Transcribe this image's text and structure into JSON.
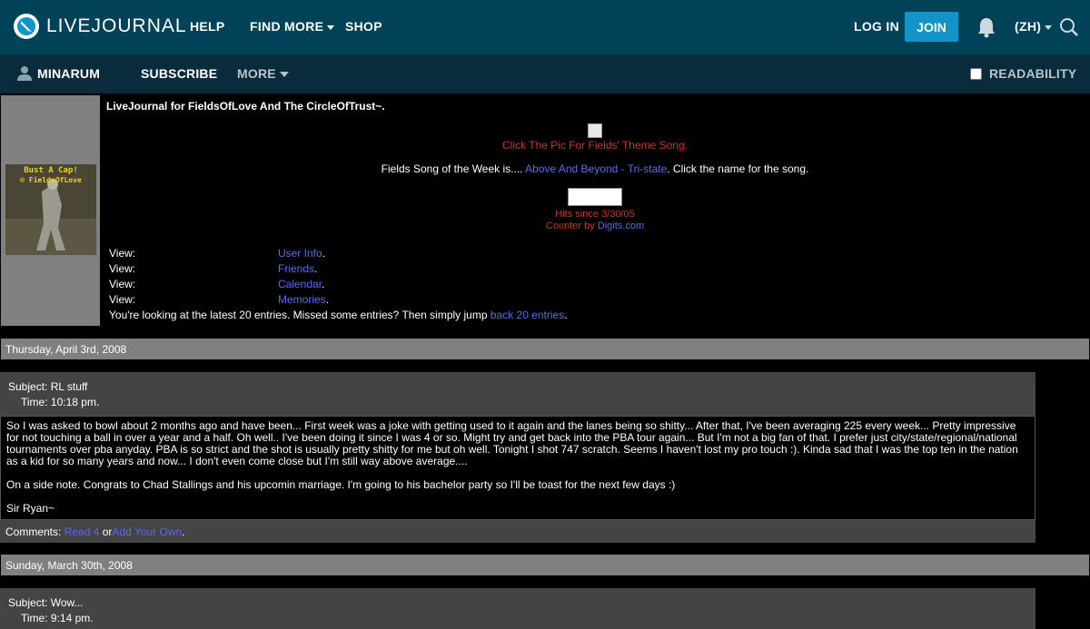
{
  "topnav": {
    "logo_text": "LIVEJOURNAL",
    "help": "HELP",
    "find_more": "FIND MORE",
    "shop": "SHOP",
    "login": "LOG IN",
    "join": "JOIN",
    "language": "(ZH)"
  },
  "subnav": {
    "username": "MINARUM",
    "subscribe": "SUBSCRIBE",
    "more": "MORE",
    "readability": "READABILITY"
  },
  "header": {
    "title": "LiveJournal for FieldsOfLove And The CircleOfTrust~.",
    "theme_song": "Click The Pic For Fields' Theme Song.",
    "song_week_prefix": "Fields Song of the Week is.... ",
    "song_link": "Above And Beyond - Tri-state",
    "song_week_suffix": ". Click the name for the song.",
    "hits": "Hits since 3/30/05",
    "counter_prefix": "Counter by ",
    "counter_link": "Digits.com",
    "avatar_caption_1": "Bust A Cap!",
    "avatar_caption_2": "© FieldsOfLove",
    "views": [
      {
        "label": "View:",
        "link": "User Info",
        "suffix": "."
      },
      {
        "label": "View:",
        "link": "Friends",
        "suffix": "."
      },
      {
        "label": "View:",
        "link": "Calendar",
        "suffix": "."
      },
      {
        "label": "View:",
        "link": "Memories",
        "suffix": "."
      }
    ],
    "latest_prefix": "You're looking at the latest 20 entries. Missed some entries? Then simply jump ",
    "latest_link": "back 20 entries",
    "latest_suffix": "."
  },
  "entries": [
    {
      "date": "Thursday, April 3rd, 2008",
      "subject_label": "Subject:",
      "subject": "RL stuff",
      "time_label": "Time:",
      "time": "10:18 pm.",
      "paragraphs": [
        "So I was asked to bowl about 2 months ago and have been... First week was a joke with getting used to it again and the lanes being so shitty... After that, I've been averaging 225 every week... Pretty impressive for not touching a ball in over a year and a half. Oh well.. I've been doing it since I was 4 or so. Might try and get back into the PBA tour again... But I'm not a big fan of that. I prefer just city/state/regional/national tournaments over pba anyday. PBA is so strict and the shot is usually pretty shitty for me but oh well. Tonight I shot 747 scratch. Seems I haven't lost my pro touch :). Kinda sad that I was the top ten in the nation as a kid for so many years and now... I don't even come close but I'm still way above average....",
        "On a side note. Congrats to Chad Stallings and his upcomin marriage. I'm going to his bachelor party so I'll be toast for the next few days :)",
        "Sir Ryan~"
      ],
      "comments_label": "Comments:",
      "read_link": "Read 4",
      "or_text": "or",
      "add_link": "Add Your Own",
      "end_text": "."
    },
    {
      "date": "Sunday, March 30th, 2008",
      "subject_label": "Subject:",
      "subject": "Wow...",
      "time_label": "Time:",
      "time": "9:14 pm."
    }
  ],
  "colors": {
    "topbar": "#004359",
    "subbar": "#0a2b3b",
    "join": "#1194c9",
    "link": "#5c6ae8",
    "red_text": "#c0392b",
    "date_bar": "#808080",
    "entry_header": "#444444"
  }
}
